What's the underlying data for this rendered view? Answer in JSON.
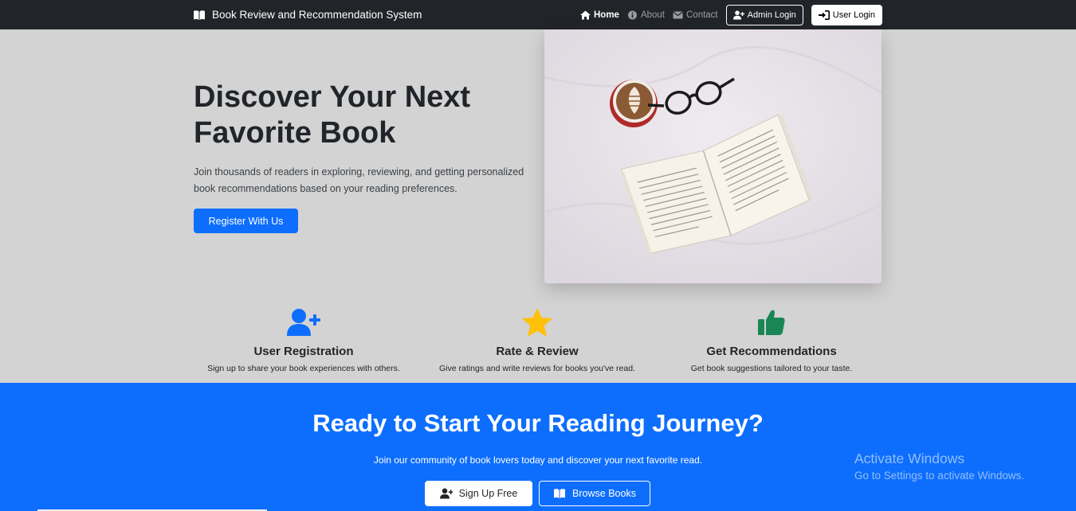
{
  "navbar": {
    "brand": "Book Review and Recommendation System",
    "links": {
      "home": "Home",
      "about": "About",
      "contact": "Contact"
    },
    "admin_login": "Admin Login",
    "user_login": "User Login"
  },
  "hero": {
    "title": "Discover Your Next Favorite Book",
    "text": "Join thousands of readers in exploring, reviewing, and getting personalized book recommendations based on your reading preferences.",
    "button": "Register With Us"
  },
  "features": [
    {
      "title": "User Registration",
      "desc": "Sign up to share your book experiences with others.",
      "icon": "user-plus-icon",
      "color": "#0d6efd"
    },
    {
      "title": "Rate & Review",
      "desc": "Give ratings and write reviews for books you've read.",
      "icon": "star-icon",
      "color": "#ffc107"
    },
    {
      "title": "Get Recommendations",
      "desc": "Get book suggestions tailored to your taste.",
      "icon": "thumbs-up-icon",
      "color": "#198754"
    }
  ],
  "cta": {
    "title": "Ready to Start Your Reading Journey?",
    "text": "Join our community of book lovers today and discover your next favorite read.",
    "signup": "Sign Up Free",
    "browse": "Browse Books"
  },
  "watermark": {
    "line1": "Activate Windows",
    "line2": "Go to Settings to activate Windows."
  },
  "colors": {
    "navbar": "#212529",
    "primary": "#0d6efd",
    "hero_bg": "#d3d3d3"
  }
}
